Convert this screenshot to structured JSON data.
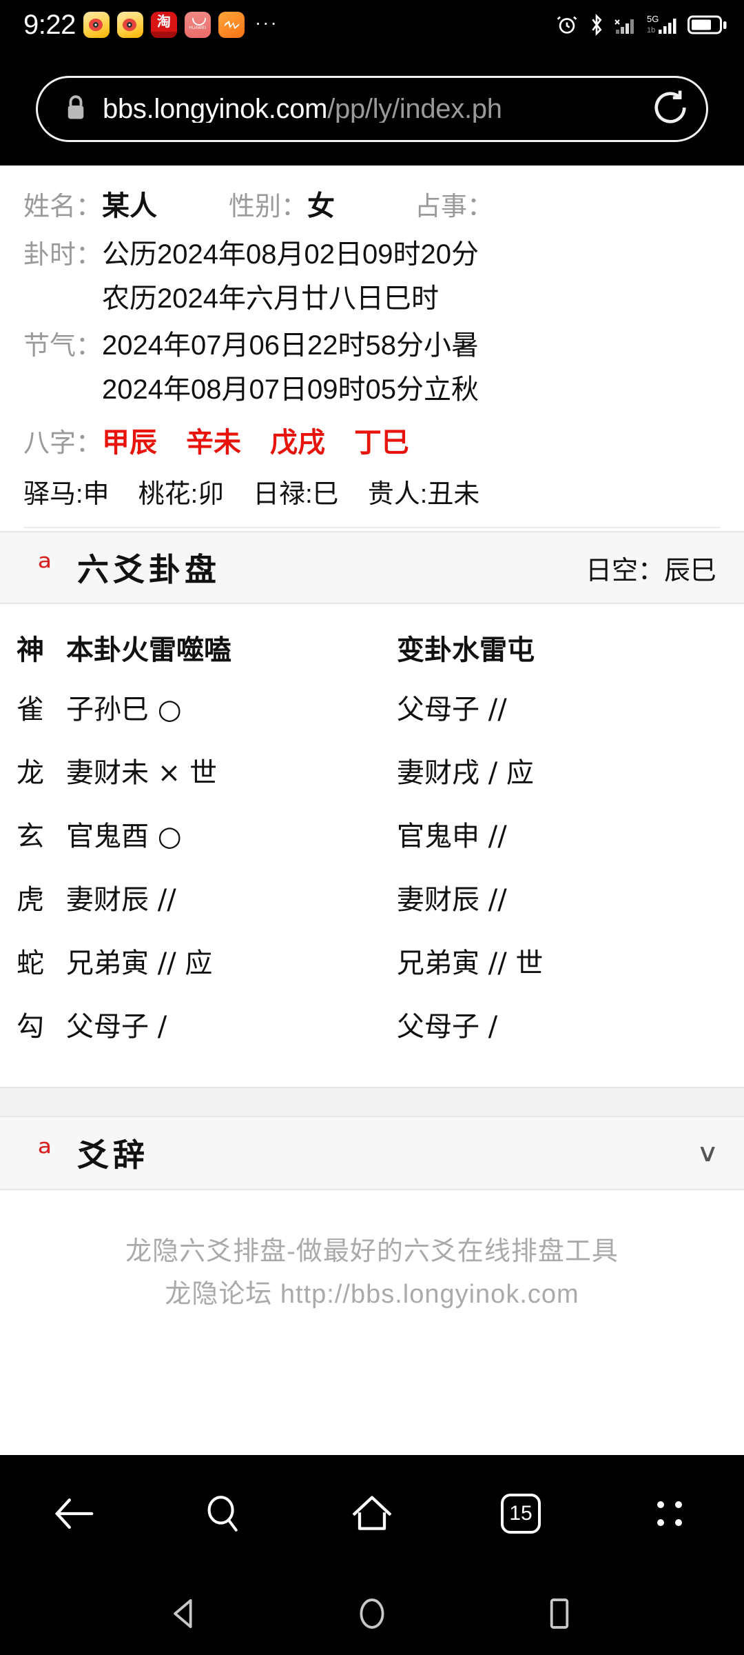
{
  "status_bar": {
    "clock": "9:22",
    "app_icons": [
      "weibo-icon",
      "weibo-icon",
      "taobao-icon",
      "huawei-icon",
      "orange-app-icon"
    ],
    "overflow": "···",
    "right_icons": [
      "alarm-icon",
      "bluetooth-icon",
      "signal-bars-icon",
      "5g-signal-icon",
      "battery-icon"
    ],
    "network_label": "5G"
  },
  "browser": {
    "url_secure_host": "bbs.longyinok.com",
    "url_path": "/pp/ly/index.ph",
    "lock_icon": "lock-icon",
    "reload_icon": "reload-icon",
    "nav": {
      "back_label": "back-arrow-icon",
      "search_label": "search-icon",
      "home_label": "home-icon",
      "tab_count": "15",
      "menu_label": "menu-dots-icon"
    }
  },
  "page": {
    "info": {
      "name_label": "姓名：",
      "name_value": "某人",
      "gender_label": "性别：",
      "gender_value": "女",
      "topic_label": "占事：",
      "topic_value": "",
      "time_label": "卦时：",
      "time_solar": "公历2024年08月02日09时20分",
      "time_lunar": "农历2024年六月廿八日巳时",
      "term_label": "节气：",
      "term_1": "2024年07月06日22时58分小暑",
      "term_2": "2024年08月07日09时05分立秋",
      "bazi_label": "八字：",
      "bazi": [
        "甲辰",
        "辛未",
        "戊戌",
        "丁巳"
      ],
      "bazi_color": "#e8140c",
      "shen_sha": [
        "驿马:申",
        "桃花:卯",
        "日禄:巳",
        "贵人:丑未"
      ]
    },
    "section_hexagram": {
      "icon": "dragon-icon",
      "title": "六爻卦盘",
      "right_label": "日空：",
      "right_value": "辰巳"
    },
    "hexagram_table": {
      "header": {
        "god": "神",
        "main": "本卦火雷噬嗑",
        "changed": "变卦水雷屯"
      },
      "rows": [
        {
          "god": "雀",
          "main": "子孙巳 ○",
          "changed": "父母子 //"
        },
        {
          "god": "龙",
          "main": "妻财未 × 世",
          "changed": "妻财戌 /  应"
        },
        {
          "god": "玄",
          "main": "官鬼酉 ○",
          "changed": "官鬼申 //"
        },
        {
          "god": "虎",
          "main": "妻财辰 //",
          "changed": "妻财辰 //"
        },
        {
          "god": "蛇",
          "main": "兄弟寅 // 应",
          "changed": "兄弟寅 // 世"
        },
        {
          "god": "勾",
          "main": "父母子 /",
          "changed": "父母子 /"
        }
      ]
    },
    "section_yaoci": {
      "icon": "dragon-icon",
      "title": "爻辞",
      "toggle": "∨"
    },
    "footer": {
      "line1": "龙隐六爻排盘-做最好的六爻在线排盘工具",
      "line2": "龙隐论坛 http://bbs.longyinok.com"
    }
  },
  "system_nav": {
    "back": "triangle-back-icon",
    "home": "circle-home-icon",
    "recents": "square-recents-icon"
  }
}
